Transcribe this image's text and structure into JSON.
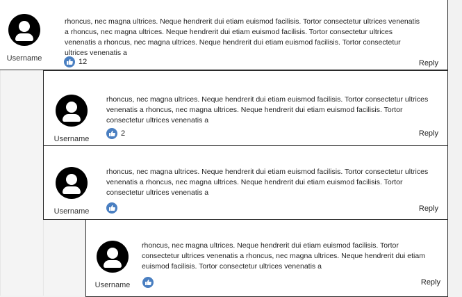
{
  "comments": [
    {
      "username": "Username",
      "text": "rhoncus, nec magna ultrices. Neque hendrerit dui etiam euismod facilisis. Tortor consectetur ultrices venenatis a rhoncus, nec magna ultrices. Neque hendrerit dui etiam euismod facilisis. Tortor consectetur ultrices venenatis a rhoncus, nec magna ultrices. Neque hendrerit dui etiam euismod facilisis. Tortor consectetur ultrices venenatis a",
      "likes": "12",
      "reply_label": "Reply"
    },
    {
      "username": "Username",
      "text": "rhoncus, nec magna ultrices. Neque hendrerit dui etiam euismod facilisis. Tortor consectetur ultrices venenatis a  rhoncus, nec magna ultrices. Neque hendrerit dui etiam euismod facilisis. Tortor consectetur ultrices venenatis a",
      "likes": "2",
      "reply_label": "Reply"
    },
    {
      "username": "Username",
      "text": "rhoncus, nec magna ultrices. Neque hendrerit dui etiam euismod facilisis. Tortor consectetur ultrices venenatis a  rhoncus, nec magna ultrices. Neque hendrerit dui etiam euismod facilisis. Tortor consectetur ultrices venenatis a",
      "likes": "",
      "reply_label": "Reply"
    },
    {
      "username": "Username",
      "text": "rhoncus, nec magna ultrices. Neque hendrerit dui etiam euismod facilisis. Tortor consectetur ultrices venenatis a  rhoncus, nec magna ultrices. Neque hendrerit dui etiam euismod facilisis. Tortor consectetur ultrices venenatis a",
      "likes": "",
      "reply_label": "Reply"
    }
  ],
  "colors": {
    "like_icon": "#4a7fc1",
    "avatar": "#000000",
    "border": "#2a2a2a"
  },
  "icons": {
    "avatar": "user-avatar-icon",
    "like": "thumbs-up-icon"
  }
}
